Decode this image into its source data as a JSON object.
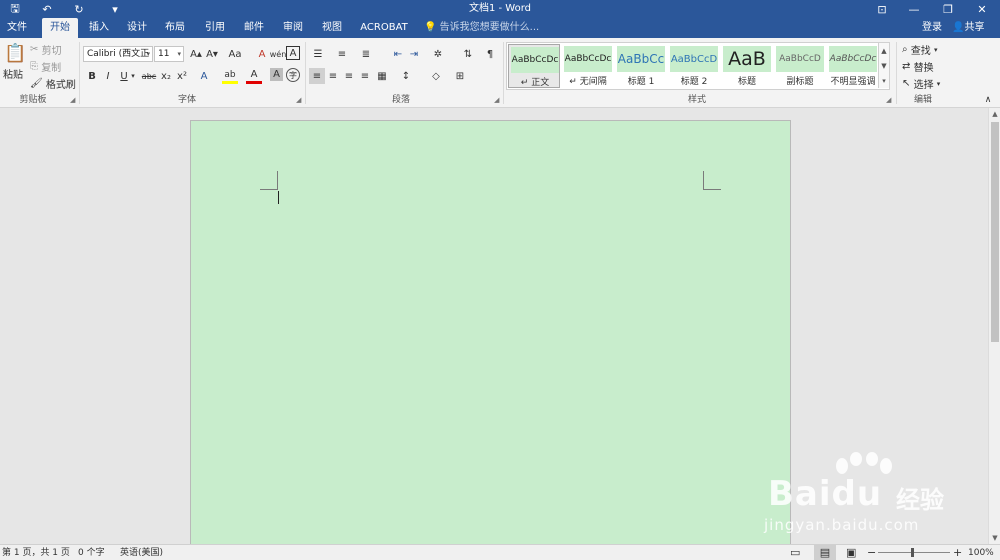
{
  "titlebar": {
    "title": "文档1 - Word",
    "qa_save_icon": "save-icon",
    "qa_undo_icon": "undo-icon",
    "qa_redo_icon": "redo-icon",
    "qa_customize_icon": "customize-icon",
    "ribbon_display_icon": "ribbon-display-icon",
    "minimize": "—",
    "restore": "❐",
    "close": "✕",
    "save_glyph": "🖫",
    "undo_glyph": "↶",
    "redo_glyph": "↻",
    "customize_glyph": "▾",
    "ribbon_glyph": "⊡"
  },
  "tabs": [
    {
      "label": "文件"
    },
    {
      "label": "开始"
    },
    {
      "label": "插入"
    },
    {
      "label": "设计"
    },
    {
      "label": "布局"
    },
    {
      "label": "引用"
    },
    {
      "label": "邮件"
    },
    {
      "label": "审阅"
    },
    {
      "label": "视图"
    },
    {
      "label": "ACROBAT"
    }
  ],
  "tell_me": "告诉我您想要做什么...",
  "tell_me_glyph": "💡",
  "account": {
    "login": "登录",
    "share": "共享",
    "share_glyph": "👤"
  },
  "clipboard": {
    "paste": "粘贴",
    "paste_glyph": "📋",
    "cut": "剪切",
    "cut_glyph": "✂",
    "copy": "复制",
    "copy_glyph": "⎘",
    "format_painter": "格式刷",
    "format_painter_glyph": "🖌",
    "label": "剪贴板"
  },
  "font": {
    "name": "Calibri (西文正",
    "size": "11",
    "grow": "A▴",
    "shrink": "A▾",
    "case": "Aa",
    "clear": "A",
    "phonetic": "wén",
    "border_char": "A",
    "bold": "B",
    "italic": "I",
    "underline": "U",
    "strike": "abc",
    "subscript": "x₂",
    "superscript": "x²",
    "effects": "A",
    "highlight": "ab",
    "color": "A",
    "shading": "A",
    "enclose": "字",
    "label": "字体",
    "accent_highlight": "#ffff00",
    "accent_color": "#e00000"
  },
  "paragraph": {
    "bullets": "☰",
    "numbering": "≡",
    "multilevel": "≣",
    "dec_indent": "⇤",
    "inc_indent": "⇥",
    "chinese_layout": "✲",
    "sort": "⇅",
    "show_marks": "¶",
    "align_left": "≡",
    "center": "≡",
    "align_right": "≡",
    "justify": "≡",
    "distributed": "▦",
    "line_spacing": "↕",
    "shading": "◇",
    "borders": "⊞",
    "label": "段落"
  },
  "styles": {
    "label": "样式",
    "items": [
      {
        "preview": "AaBbCcDc",
        "name": "↵ 正文"
      },
      {
        "preview": "AaBbCcDc",
        "name": "↵ 无间隔"
      },
      {
        "preview": "AaBbCc",
        "name": "标题 1"
      },
      {
        "preview": "AaBbCcD",
        "name": "标题 2"
      },
      {
        "preview": "AaB",
        "name": "标题"
      },
      {
        "preview": "AaBbCcD",
        "name": "副标题"
      },
      {
        "preview": "AaBbCcDc",
        "name": "不明显强调"
      }
    ],
    "scroll_up": "▲",
    "scroll_down": "▼",
    "more": "▾"
  },
  "editing": {
    "find": "查找",
    "find_glyph": "⌕",
    "replace": "替换",
    "replace_glyph": "⇄",
    "select": "选择",
    "select_glyph": "↖",
    "label": "编辑",
    "collapse_glyph": "∧"
  },
  "status": {
    "page": "第 1 页，共 1 页",
    "words": "0 个字",
    "language": "英语(美国)",
    "read_mode_glyph": "▭",
    "print_layout_glyph": "▤",
    "web_layout_glyph": "▣",
    "zoom_out": "−",
    "zoom_in": "+",
    "zoom": "100%"
  },
  "vscroll": {
    "up": "▲",
    "down": "▼"
  },
  "watermark": {
    "brand": "Bai",
    "brand2": "du",
    "cn": "经验",
    "url": "jingyan.baidu.com"
  },
  "colors": {
    "title_bg": "#2b579a",
    "ribbon_bg": "#f3f3f3",
    "page_bg": "#c8edcc",
    "workspace_bg": "#e6e6e6"
  }
}
